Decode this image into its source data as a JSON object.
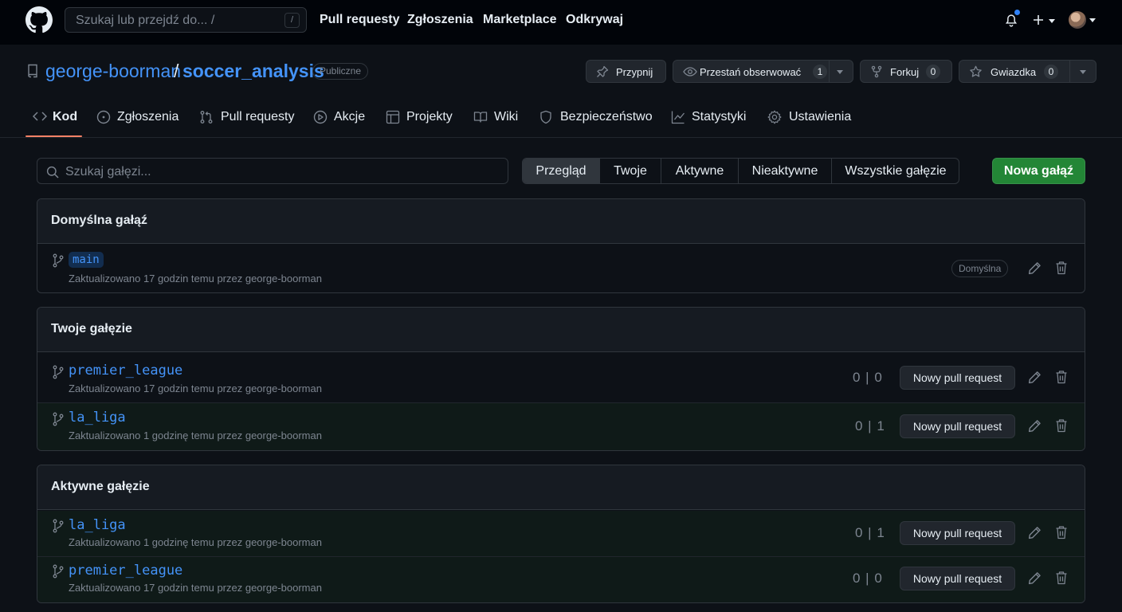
{
  "header": {
    "search_placeholder": "Szukaj lub przejdź do... /",
    "search_shortcut": "/",
    "nav": [
      "Pull requesty",
      "Zgłoszenia",
      "Marketplace",
      "Odkrywaj"
    ]
  },
  "repo": {
    "owner": "george-boorman",
    "separator": "/",
    "name": "soccer_analysis",
    "visibility": "Publiczne",
    "actions": {
      "pin": "Przypnij",
      "unwatch": "Przestań obserwować",
      "watch_count": "1",
      "fork": "Forkuj",
      "fork_count": "0",
      "star": "Gwiazdka",
      "star_count": "0"
    }
  },
  "tabs": [
    "Kod",
    "Zgłoszenia",
    "Pull requesty",
    "Akcje",
    "Projekty",
    "Wiki",
    "Bezpieczeństwo",
    "Statystyki",
    "Ustawienia"
  ],
  "toolbar": {
    "search_placeholder": "Szukaj gałęzi...",
    "filters": [
      "Przegląd",
      "Twoje",
      "Aktywne",
      "Nieaktywne",
      "Wszystkie gałęzie"
    ],
    "active_filter": "Przegląd",
    "new_branch": "Nowa gałąź"
  },
  "sections": {
    "default": {
      "title": "Domyślna gałąź",
      "branch": "main",
      "meta": "Zaktualizowano 17 godzin temu przez george-boorman",
      "badge": "Domyślna"
    },
    "yours": {
      "title": "Twoje gałęzie",
      "branches": [
        {
          "name": "premier_league",
          "meta": "Zaktualizowano 17 godzin temu przez george-boorman",
          "ahead_behind": "0 | 0",
          "pr_label": "Nowy pull request"
        },
        {
          "name": "la_liga",
          "meta": "Zaktualizowano 1 godzinę temu przez george-boorman",
          "ahead_behind": "0 | 1",
          "pr_label": "Nowy pull request"
        }
      ]
    },
    "active": {
      "title": "Aktywne gałęzie",
      "branches": [
        {
          "name": "la_liga",
          "meta": "Zaktualizowano 1 godzinę temu przez george-boorman",
          "ahead_behind": "0 | 1",
          "pr_label": "Nowy pull request"
        },
        {
          "name": "premier_league",
          "meta": "Zaktualizowano 17 godzin temu przez george-boorman",
          "ahead_behind": "0 | 0",
          "pr_label": "Nowy pull request"
        }
      ]
    }
  },
  "colors": {
    "background": "#0d1117",
    "link": "#4493f8",
    "accent_underline": "#f78166",
    "primary_button": "#238636"
  }
}
